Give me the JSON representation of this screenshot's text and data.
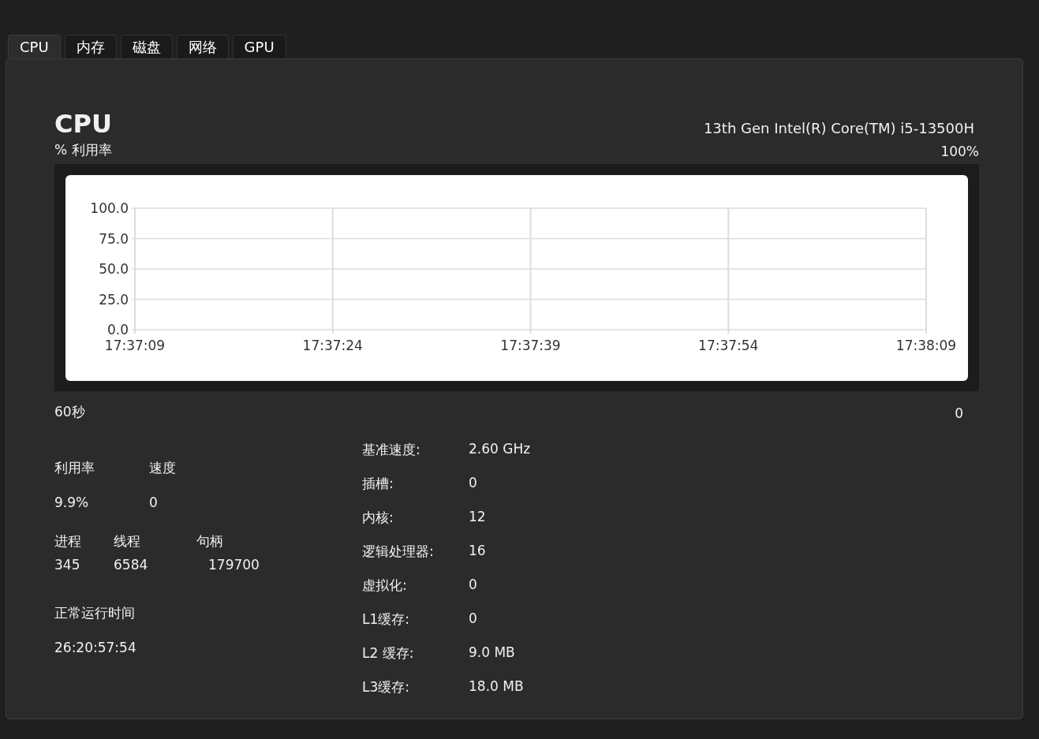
{
  "tabs": [
    {
      "label": "CPU",
      "selected": true
    },
    {
      "label": "内存",
      "selected": false
    },
    {
      "label": "磁盘",
      "selected": false
    },
    {
      "label": "网络",
      "selected": false
    },
    {
      "label": "GPU",
      "selected": false
    }
  ],
  "header": {
    "title": "CPU",
    "model": "13th Gen Intel(R) Core(TM) i5-13500H",
    "utilization_label": "% 利用率",
    "max_label": "100%"
  },
  "chart": {
    "chart_data": {
      "type": "line",
      "grid": true,
      "ylim": [
        0,
        100
      ],
      "yticks": [
        {
          "value": 0,
          "label": "0.0"
        },
        {
          "value": 25,
          "label": "25.0"
        },
        {
          "value": 50,
          "label": "50.0"
        },
        {
          "value": 75,
          "label": "75.0"
        },
        {
          "value": 100,
          "label": "100.0"
        }
      ],
      "categories": [
        "17:37:09",
        "17:37:24",
        "17:37:39",
        "17:37:54",
        "17:38:09"
      ]
    }
  },
  "chart_footer": {
    "time_span": "60秒",
    "min_label": "0"
  },
  "usage": [
    {
      "label": "利用率",
      "value": "9.9%"
    },
    {
      "label": "速度",
      "value": "0"
    }
  ],
  "counts": [
    {
      "label": "进程",
      "value": "345"
    },
    {
      "label": "线程",
      "value": "6584"
    },
    {
      "label": "句柄",
      "value": "179700"
    }
  ],
  "uptime": {
    "label": "正常运行时间",
    "value": "26:20:57:54"
  },
  "specs": [
    {
      "label": "基准速度:",
      "value": "2.60 GHz"
    },
    {
      "label": "插槽:",
      "value": "0"
    },
    {
      "label": "内核:",
      "value": "12"
    },
    {
      "label": "逻辑处理器:",
      "value": "16"
    },
    {
      "label": "虚拟化:",
      "value": "0"
    },
    {
      "label": "L1缓存:",
      "value": "0"
    },
    {
      "label": "L2 缓存:",
      "value": "9.0 MB"
    },
    {
      "label": "L3缓存:",
      "value": "18.0 MB"
    }
  ]
}
